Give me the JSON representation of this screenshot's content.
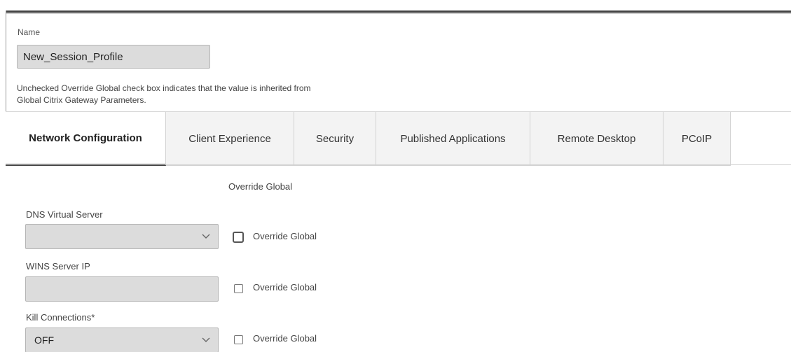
{
  "form": {
    "name_label": "Name",
    "name_value": "New_Session_Profile",
    "note_line1": "Unchecked Override Global check box indicates that the value is inherited from",
    "note_line2": "Global Citrix Gateway Parameters."
  },
  "tabs": [
    {
      "label": "Network Configuration",
      "active": true
    },
    {
      "label": "Client Experience",
      "active": false
    },
    {
      "label": "Security",
      "active": false
    },
    {
      "label": "Published Applications",
      "active": false
    },
    {
      "label": "Remote Desktop",
      "active": false
    },
    {
      "label": "PCoIP",
      "active": false
    }
  ],
  "network": {
    "column_header": "Override Global",
    "fields": [
      {
        "label": "DNS Virtual Server",
        "value": "",
        "override_label": "Override Global",
        "override_checked": false
      },
      {
        "label": "WINS Server IP",
        "value": "",
        "override_label": "Override Global",
        "override_checked": false
      },
      {
        "label": "Kill Connections*",
        "value": "OFF",
        "override_label": "Override Global",
        "override_checked": false
      }
    ]
  },
  "icons": {
    "dropdown": "chevron-down-icon"
  }
}
